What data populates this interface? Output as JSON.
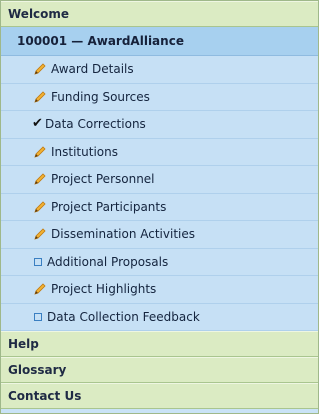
{
  "sections": {
    "welcome": "Welcome",
    "help": "Help",
    "glossary": "Glossary",
    "contact": "Contact Us"
  },
  "project": {
    "label": "100001 — AwardAlliance"
  },
  "items": [
    {
      "label": "Award Details",
      "icon": "pencil-icon"
    },
    {
      "label": "Funding Sources",
      "icon": "pencil-icon"
    },
    {
      "label": "Data Corrections",
      "icon": "checkmark-icon"
    },
    {
      "label": "Institutions",
      "icon": "pencil-icon"
    },
    {
      "label": "Project Personnel",
      "icon": "pencil-icon"
    },
    {
      "label": "Project Participants",
      "icon": "pencil-icon"
    },
    {
      "label": "Dissemination Activities",
      "icon": "pencil-icon"
    },
    {
      "label": "Additional Proposals",
      "icon": "empty-square-icon"
    },
    {
      "label": "Project Highlights",
      "icon": "pencil-icon"
    },
    {
      "label": "Data Collection Feedback",
      "icon": "empty-square-icon"
    }
  ],
  "colors": {
    "section_bg": "#dbebc3",
    "project_bg": "#a7d0ef",
    "item_bg": "#c6e0f5",
    "pencil": "#f0a020"
  }
}
